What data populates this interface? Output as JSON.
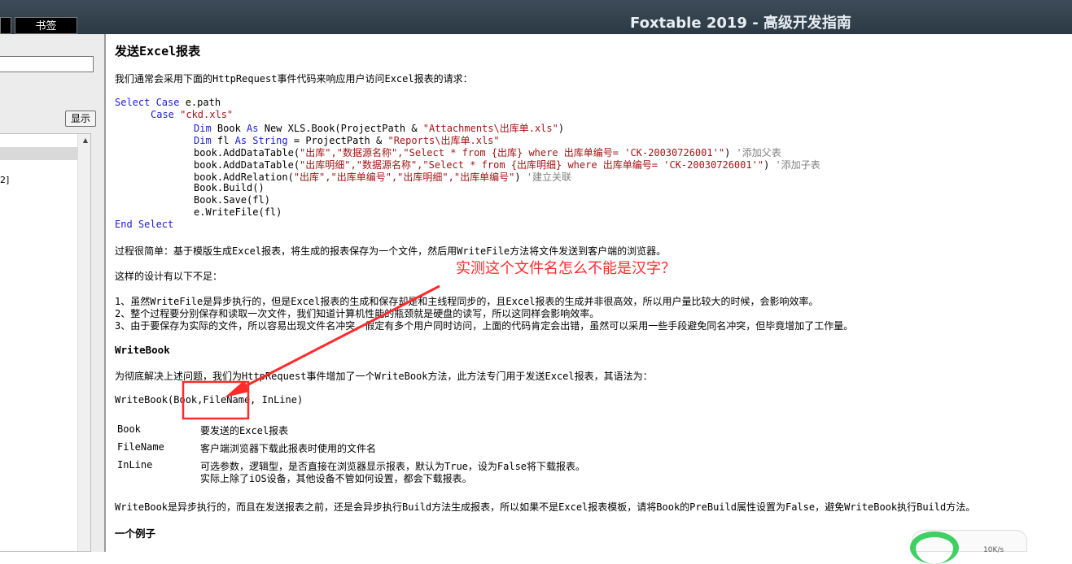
{
  "window": {
    "title": "Foxtable 2019 - 高级开发指南",
    "tab_prev": "",
    "tab_bookmark": "书签"
  },
  "sidebar": {
    "search_value": "",
    "show_button": "显示",
    "item_partial": "2]"
  },
  "doc": {
    "title": "发送Excel报表",
    "intro": "我们通常会采用下面的HttpRequest事件代码来响应用户访问Excel报表的请求：",
    "code": {
      "l1_kw": "Select Case",
      "l1_rest": " e.path",
      "l2_kw": "Case",
      "l2_str": " \"ckd.xls\"",
      "l3_kw1": "Dim",
      "l3_a": " Book ",
      "l3_kw2": "As",
      "l3_b": " New XLS.Book(ProjectPath & ",
      "l3_str": "\"Attachments\\出库单.xls\"",
      "l3_c": ")",
      "l4_kw1": "Dim",
      "l4_a": " fl ",
      "l4_kw2": "As",
      "l4_sp": " ",
      "l4_kw3": "String",
      "l4_b": " = ProjectPath & ",
      "l4_str": "\"Reports\\出库单.xls\"",
      "l5_a": "book.AddDataTable(",
      "l5_str": "\"出库\",\"数据源名称\",\"Select * from {出库} where 出库单编号= 'CK-20030726001'\"",
      "l5_b": ") ",
      "l5_cm": "'添加父表",
      "l6_a": "book.AddDataTable(",
      "l6_str": "\"出库明细\",\"数据源名称\",\"Select * from {出库明细} where 出库单编号= 'CK-20030726001'\"",
      "l6_b": ") ",
      "l6_cm": "'添加子表",
      "l7_a": "book.AddRelation(",
      "l7_str": "\"出库\",\"出库单编号\",\"出库明细\",\"出库单编号\"",
      "l7_b": ") ",
      "l7_cm": "'建立关联",
      "l8": "Book.Build()",
      "l9": "Book.Save(fl)",
      "l10": "e.WriteFile(fl)",
      "l11_kw": "End Select"
    },
    "p_simple": "过程很简单：基于模版生成Excel报表，将生成的报表保存为一个文件，然后用WriteFile方法将文件发送到客户端的浏览器。",
    "p_flaws": "这样的设计有以下不足：",
    "flaw1": "1、虽然WriteFile是异步执行的，但是Excel报表的生成和保存却是和主线程同步的，且Excel报表的生成并非很高效，所以用户量比较大的时候，会影响效率。",
    "flaw2": "2、整个过程要分别保存和读取一次文件，我们知道计算机性能的瓶颈就是硬盘的读写，所以这同样会影响效率。",
    "flaw3": "3、由于要保存为实际的文件，所以容易出现文件名冲突，假定有多个用户同时访问，上面的代码肯定会出错，虽然可以采用一些手段避免同名冲突，但毕竟增加了工作量。",
    "h_writebook": "WriteBook",
    "p_wb_intro": "为彻底解决上述问题，我们为HttpRequest事件增加了一个WriteBook方法，此方法专门用于发送Excel报表，其语法为：",
    "syntax": "WriteBook(Book,FileName, InLine)",
    "params": [
      {
        "name": "Book",
        "desc": "要发送的Excel报表"
      },
      {
        "name": "FileName",
        "desc": "客户端浏览器下载此报表时使用的文件名"
      },
      {
        "name": "InLine",
        "desc": "可选参数，逻辑型，是否直接在浏览器显示报表，默认为True，设为False将下载报表。",
        "desc2": "实际上除了iOS设备，其他设备不管如何设置，都会下载报表。"
      }
    ],
    "p_async": "WriteBook是异步执行的，而且在发送报表之前，还是会异步执行Build方法生成报表，所以如果不是Excel报表模板，请将Book的PreBuild属性设置为False，避免WriteBook执行Build方法。",
    "h_example": "一个例子"
  },
  "annotation": {
    "question": "实测这个文件名怎么不能是汉字？",
    "color": "#ff2b2b"
  },
  "widget": {
    "speed": "10K/s"
  }
}
